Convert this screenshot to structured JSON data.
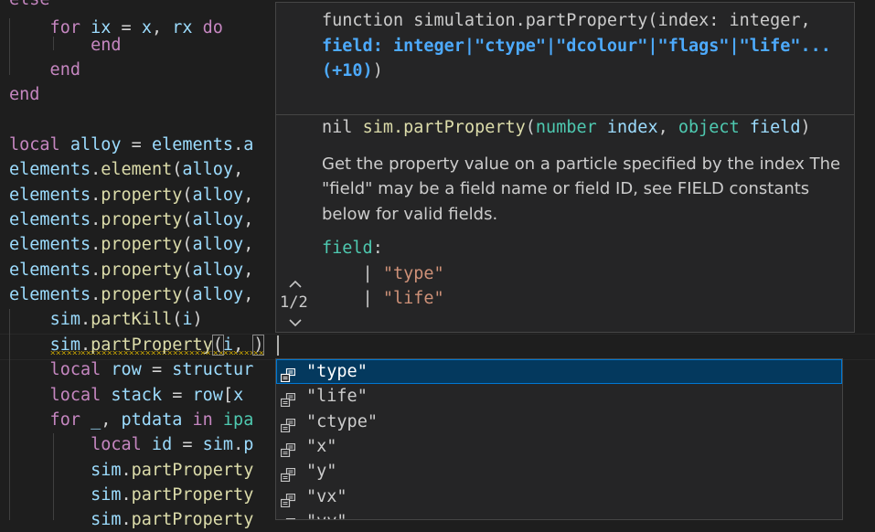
{
  "editor": {
    "lines": [
      {
        "parts": [
          [
            "kw",
            "else"
          ]
        ]
      },
      {
        "parts": [
          [
            "kw",
            "    for"
          ],
          [
            "var",
            " ix"
          ],
          [
            "plain",
            " = "
          ],
          [
            "var",
            "x"
          ],
          [
            "plain",
            ", "
          ],
          [
            "var",
            "rx"
          ],
          [
            "kw",
            " do"
          ]
        ]
      },
      {
        "parts": [
          [
            "kw",
            "        end"
          ]
        ]
      },
      {
        "parts": [
          [
            "kw",
            "    end"
          ]
        ]
      },
      {
        "parts": [
          [
            "kw",
            "end"
          ]
        ]
      },
      {
        "parts": []
      },
      {
        "parts": [
          [
            "kw",
            "local"
          ],
          [
            "var",
            " alloy"
          ],
          [
            "plain",
            " = "
          ],
          [
            "var",
            "elements"
          ],
          [
            "plain",
            "."
          ],
          [
            "var",
            "a"
          ]
        ]
      },
      {
        "parts": [
          [
            "var",
            "elements"
          ],
          [
            "plain",
            "."
          ],
          [
            "fn",
            "element"
          ],
          [
            "plain",
            "("
          ],
          [
            "var",
            "alloy"
          ],
          [
            "plain",
            ","
          ]
        ]
      },
      {
        "parts": [
          [
            "var",
            "elements"
          ],
          [
            "plain",
            "."
          ],
          [
            "fn",
            "property"
          ],
          [
            "plain",
            "("
          ],
          [
            "var",
            "alloy"
          ],
          [
            "plain",
            ","
          ]
        ]
      },
      {
        "parts": [
          [
            "var",
            "elements"
          ],
          [
            "plain",
            "."
          ],
          [
            "fn",
            "property"
          ],
          [
            "plain",
            "("
          ],
          [
            "var",
            "alloy"
          ],
          [
            "plain",
            ","
          ]
        ]
      },
      {
        "parts": [
          [
            "var",
            "elements"
          ],
          [
            "plain",
            "."
          ],
          [
            "fn",
            "property"
          ],
          [
            "plain",
            "("
          ],
          [
            "var",
            "alloy"
          ],
          [
            "plain",
            ","
          ]
        ]
      },
      {
        "parts": [
          [
            "var",
            "elements"
          ],
          [
            "plain",
            "."
          ],
          [
            "fn",
            "property"
          ],
          [
            "plain",
            "("
          ],
          [
            "var",
            "alloy"
          ],
          [
            "plain",
            ","
          ]
        ]
      },
      {
        "parts": [
          [
            "var",
            "elements"
          ],
          [
            "plain",
            "."
          ],
          [
            "fn",
            "property"
          ],
          [
            "plain",
            "("
          ],
          [
            "var",
            "alloy"
          ],
          [
            "plain",
            ","
          ]
        ]
      },
      {
        "parts": [
          [
            "plain",
            "    "
          ],
          [
            "var",
            "sim"
          ],
          [
            "plain",
            "."
          ],
          [
            "fn",
            "partKill"
          ],
          [
            "plain",
            "("
          ],
          [
            "var",
            "i"
          ],
          [
            "plain",
            ")"
          ]
        ]
      },
      {
        "parts": [
          [
            "plain",
            "    "
          ],
          [
            "var",
            "sim"
          ],
          [
            "plain",
            "."
          ],
          [
            "fn",
            "partProperty"
          ],
          [
            "plain",
            "("
          ],
          [
            "var",
            "i"
          ],
          [
            "plain",
            ", "
          ],
          [
            "plain",
            ")"
          ]
        ]
      },
      {
        "parts": [
          [
            "kw",
            "    local"
          ],
          [
            "var",
            " row"
          ],
          [
            "plain",
            " = "
          ],
          [
            "var",
            "structur"
          ]
        ]
      },
      {
        "parts": [
          [
            "kw",
            "    local"
          ],
          [
            "var",
            " stack"
          ],
          [
            "plain",
            " = "
          ],
          [
            "var",
            "row"
          ],
          [
            "plain",
            "["
          ],
          [
            "var",
            "x"
          ]
        ]
      },
      {
        "parts": [
          [
            "kw",
            "    for"
          ],
          [
            "var",
            " _"
          ],
          [
            "plain",
            ", "
          ],
          [
            "var",
            "ptdata"
          ],
          [
            "kw",
            " in"
          ],
          [
            "fnb",
            " ipa"
          ]
        ]
      },
      {
        "parts": [
          [
            "kw",
            "        local"
          ],
          [
            "var",
            " id"
          ],
          [
            "plain",
            " = "
          ],
          [
            "var",
            "sim"
          ],
          [
            "plain",
            "."
          ],
          [
            "var",
            "p"
          ]
        ]
      },
      {
        "parts": [
          [
            "plain",
            "        "
          ],
          [
            "var",
            "sim"
          ],
          [
            "plain",
            "."
          ],
          [
            "fn",
            "partProperty"
          ]
        ]
      },
      {
        "parts": [
          [
            "plain",
            "        "
          ],
          [
            "var",
            "sim"
          ],
          [
            "plain",
            "."
          ],
          [
            "fn",
            "partProperty"
          ]
        ]
      },
      {
        "parts": [
          [
            "plain",
            "        "
          ],
          [
            "var",
            "sim"
          ],
          [
            "plain",
            "."
          ],
          [
            "fn",
            "partProperty"
          ]
        ]
      }
    ]
  },
  "signature_help": {
    "counter": "1/2",
    "head_prefix": "function simulation.partProperty(index: integer, ",
    "head_active": "field: integer|\"ctype\"|\"dcolour\"|\"flags\"|\"life\"...(+10)",
    "head_suffix": ")",
    "doc_sig": {
      "ret": "nil",
      "name": "sim.partProperty",
      "p1_type": "number",
      "p1_name": "index",
      "p2_type": "object",
      "p2_name": "field",
      "open": "(",
      "comma": ", ",
      "close": ")"
    },
    "description": "Get the property value on a particle specified by the index The \"field\" may be a field name or field ID, see FIELD constants below for valid fields.",
    "field_key": "field",
    "field_colon": ":",
    "field_values": [
      "\"type\"",
      "\"life\""
    ]
  },
  "suggestions": [
    {
      "label": "\"type\"",
      "selected": true
    },
    {
      "label": "\"life\"",
      "selected": false
    },
    {
      "label": "\"ctype\"",
      "selected": false
    },
    {
      "label": "\"x\"",
      "selected": false
    },
    {
      "label": "\"y\"",
      "selected": false
    },
    {
      "label": "\"vx\"",
      "selected": false
    },
    {
      "label": "\"vy\"",
      "selected": false
    }
  ],
  "icons": {
    "suggestion_kind": "enum-member-icon",
    "nav_up": "chevron-up-icon",
    "nav_down": "chevron-down-icon"
  },
  "colors": {
    "background": "#1e1e1e",
    "keyword": "#c586c0",
    "variable": "#9cdcfe",
    "function": "#dcdcaa",
    "string": "#ce9178",
    "active_param": "#4daafc",
    "selection": "#04395e"
  }
}
